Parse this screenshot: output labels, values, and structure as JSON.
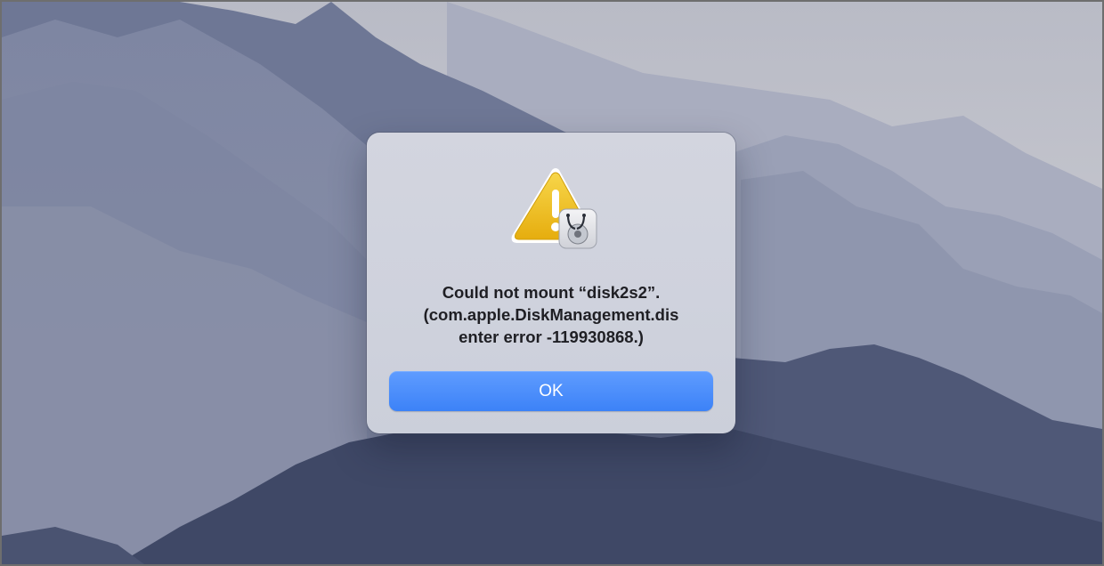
{
  "desktop": {
    "wallpaper": "mountain-landscape-wallpaper",
    "colors": {
      "sky": "#c3c4cc",
      "ridge_far": "#a5a9bd",
      "ridge_mid": "#7c84a0",
      "ridge_near": "#4d5675"
    }
  },
  "alert": {
    "icon": "warning-disk-utility-icon",
    "message_lines": [
      "Could not mount “disk2s2”.",
      "(com.apple.DiskManagement.dis",
      "enter error -119930868.)"
    ],
    "ok_label": "OK",
    "colors": {
      "panel": "#d0d3de",
      "text": "#1f1f24",
      "button": "#4b8cfa",
      "warning": "#f2c21b"
    }
  }
}
